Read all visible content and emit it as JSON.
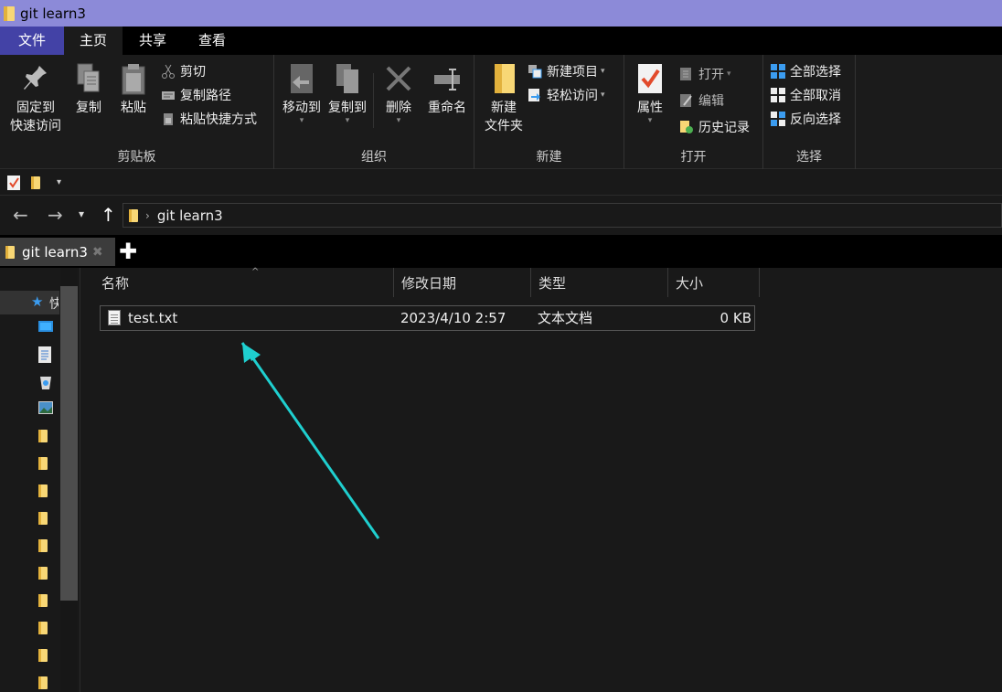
{
  "window": {
    "title": "git learn3"
  },
  "ribbon_tabs": [
    "文件",
    "主页",
    "共享",
    "查看"
  ],
  "clipboard": {
    "pin_line1": "固定到",
    "pin_line2": "快速访问",
    "copy": "复制",
    "paste": "粘贴",
    "cut": "剪切",
    "copy_path": "复制路径",
    "paste_shortcut": "粘贴快捷方式",
    "label": "剪贴板"
  },
  "organize": {
    "move_to": "移动到",
    "copy_to": "复制到",
    "delete": "删除",
    "rename": "重命名",
    "label": "组织"
  },
  "new_group": {
    "new_folder_line1": "新建",
    "new_folder_line2": "文件夹",
    "new_item": "新建项目",
    "easy_access": "轻松访问",
    "label": "新建"
  },
  "open_group": {
    "properties": "属性",
    "open": "打开",
    "edit": "编辑",
    "history": "历史记录",
    "label": "打开"
  },
  "select_group": {
    "select_all": "全部选择",
    "select_none": "全部取消",
    "invert": "反向选择",
    "label": "选择"
  },
  "address": {
    "crumb": "git learn3"
  },
  "tabs": {
    "current": "git learn3",
    "close_glyph": "✖",
    "add_glyph": "✚"
  },
  "navpane": {
    "quick_access_partial": "快"
  },
  "columns": {
    "name": "名称",
    "modified": "修改日期",
    "type": "类型",
    "size": "大小"
  },
  "files": [
    {
      "name": "test.txt",
      "modified": "2023/4/10 2:57",
      "type": "文本文档",
      "size": "0 KB"
    }
  ],
  "colors": {
    "titlebar": "#8c8ad8",
    "file_tab": "#4342a6",
    "annotation_arrow": "#1fcfcf"
  }
}
